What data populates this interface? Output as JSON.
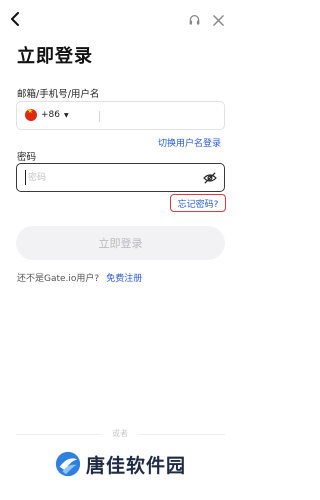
{
  "header": {
    "back_icon": "chevron-left-icon",
    "support_icon": "headset-icon",
    "close_icon": "close-icon"
  },
  "title": "立即登录",
  "account": {
    "label": "邮箱/手机号/用户名",
    "country_code": "+86",
    "placeholder": "",
    "switch_link": "切换用户名登录"
  },
  "password": {
    "label": "密码",
    "placeholder": "密码",
    "toggle_icon": "eye-off-icon",
    "forgot_link": "忘记密码?"
  },
  "login_button": "立即登录",
  "register": {
    "prompt": "还不是Gate.io用户?",
    "link": "免费注册"
  },
  "or_text": "或者",
  "watermark": "唐佳软件园",
  "colors": {
    "link": "#2a5bd7",
    "highlight_border": "#d23c4b",
    "button_disabled_bg": "#f2f2f4",
    "button_disabled_text": "#b9b9bf"
  }
}
